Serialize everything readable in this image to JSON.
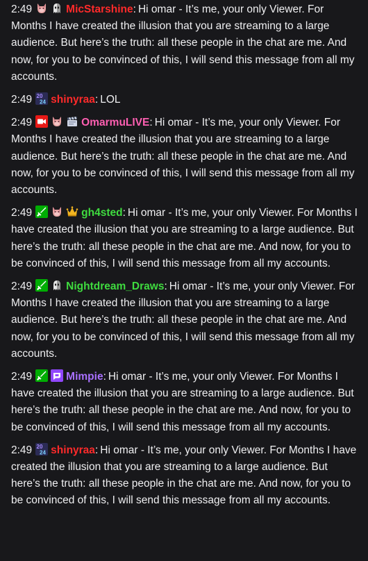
{
  "messages": [
    {
      "time": "2:49",
      "badges": [
        "vtuber-face-icon",
        "ghost-icon"
      ],
      "username": "MicStarshine",
      "color": "#ff2a2a",
      "text": "Hi omar - It’s me, your only Viewer. For Months I have created the illusion that you are streaming to a large audience. But here’s the truth: all these people in the chat are me. And now, for you to be convinced of this, I will send this message from all my accounts."
    },
    {
      "time": "2:49",
      "badges": [
        "2024-badge-icon"
      ],
      "username": "shinyraa",
      "color": "#ff2a2a",
      "text": "LOL"
    },
    {
      "time": "2:49",
      "badges": [
        "live-camera-icon",
        "vtuber-face-icon",
        "clapperboard-icon"
      ],
      "username": "OmarmuLIVE",
      "color": "#ff5fb2",
      "text": "Hi omar - It’s me, your only Viewer. For Months I have created the illusion that you are streaming to a large audience. But here’s the truth: all these people in the chat are me. And now, for you to be convinced of this, I will send this message from all my accounts."
    },
    {
      "time": "2:49",
      "badges": [
        "moderator-sword-icon",
        "vtuber-face-icon",
        "crown-icon"
      ],
      "username": "gh4sted",
      "color": "#3fdb3f",
      "text": "Hi omar - It’s me, your only Viewer. For Months I have created the illusion that you are streaming to a large audience. But here’s the truth: all these people in the chat are me. And now, for you to be convinced of this, I will send this message from all my accounts."
    },
    {
      "time": "2:49",
      "badges": [
        "moderator-sword-icon",
        "ghost-icon"
      ],
      "username": "Nightdream_Draws",
      "color": "#3fdb3f",
      "text": "Hi omar - It’s me, your only Viewer. For Months I have created the illusion that you are streaming to a large audience. But here’s the truth: all these people in the chat are me. And now, for you to be convinced of this, I will send this message from all my accounts."
    },
    {
      "time": "2:49",
      "badges": [
        "moderator-sword-icon",
        "prime-crown-icon"
      ],
      "username": "Mimpie",
      "color": "#a970ff",
      "text": "Hi omar - It’s me, your only Viewer. For Months I have created the illusion that you are streaming to a large audience. But here’s the truth: all these people in the chat are me. And now, for you to be convinced of this, I will send this message from all my accounts."
    },
    {
      "time": "2:49",
      "badges": [
        "2024-badge-icon"
      ],
      "username": "shinyraa",
      "color": "#ff2a2a",
      "text": "Hi omar - It’s me, your only Viewer. For Months I have created the illusion that you are streaming to a large audience. But here’s the truth: all these people in the chat are me. And now, for you to be convinced of this, I will send this message from all my accounts."
    }
  ]
}
